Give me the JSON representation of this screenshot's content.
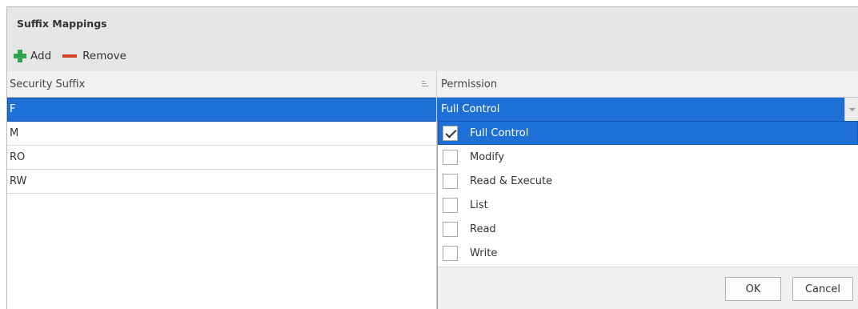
{
  "panel": {
    "title": "Suffix Mappings"
  },
  "toolbar": {
    "add_label": "Add",
    "remove_label": "Remove"
  },
  "grid": {
    "columns": [
      "Security Suffix",
      "Permission"
    ],
    "rows": [
      {
        "suffix": "F",
        "selected": true
      },
      {
        "suffix": "M"
      },
      {
        "suffix": "RO"
      },
      {
        "suffix": "RW"
      }
    ],
    "editor_value": "Full Control"
  },
  "permission_dropdown": {
    "options": [
      {
        "label": "Full Control",
        "checked": true,
        "highlighted": true
      },
      {
        "label": "Modify",
        "checked": false
      },
      {
        "label": "Read & Execute",
        "checked": false
      },
      {
        "label": "List",
        "checked": false
      },
      {
        "label": "Read",
        "checked": false
      },
      {
        "label": "Write",
        "checked": false
      }
    ],
    "ok_label": "OK",
    "cancel_label": "Cancel"
  },
  "icons": {
    "add": "plus-icon",
    "remove": "minus-icon",
    "sort": "sort-icon",
    "dropdown": "chevron-down-icon",
    "check": "check-icon"
  },
  "colors": {
    "selection": "#1e6fd6",
    "add_icon": "#2ea44f",
    "remove_icon": "#d44020"
  }
}
